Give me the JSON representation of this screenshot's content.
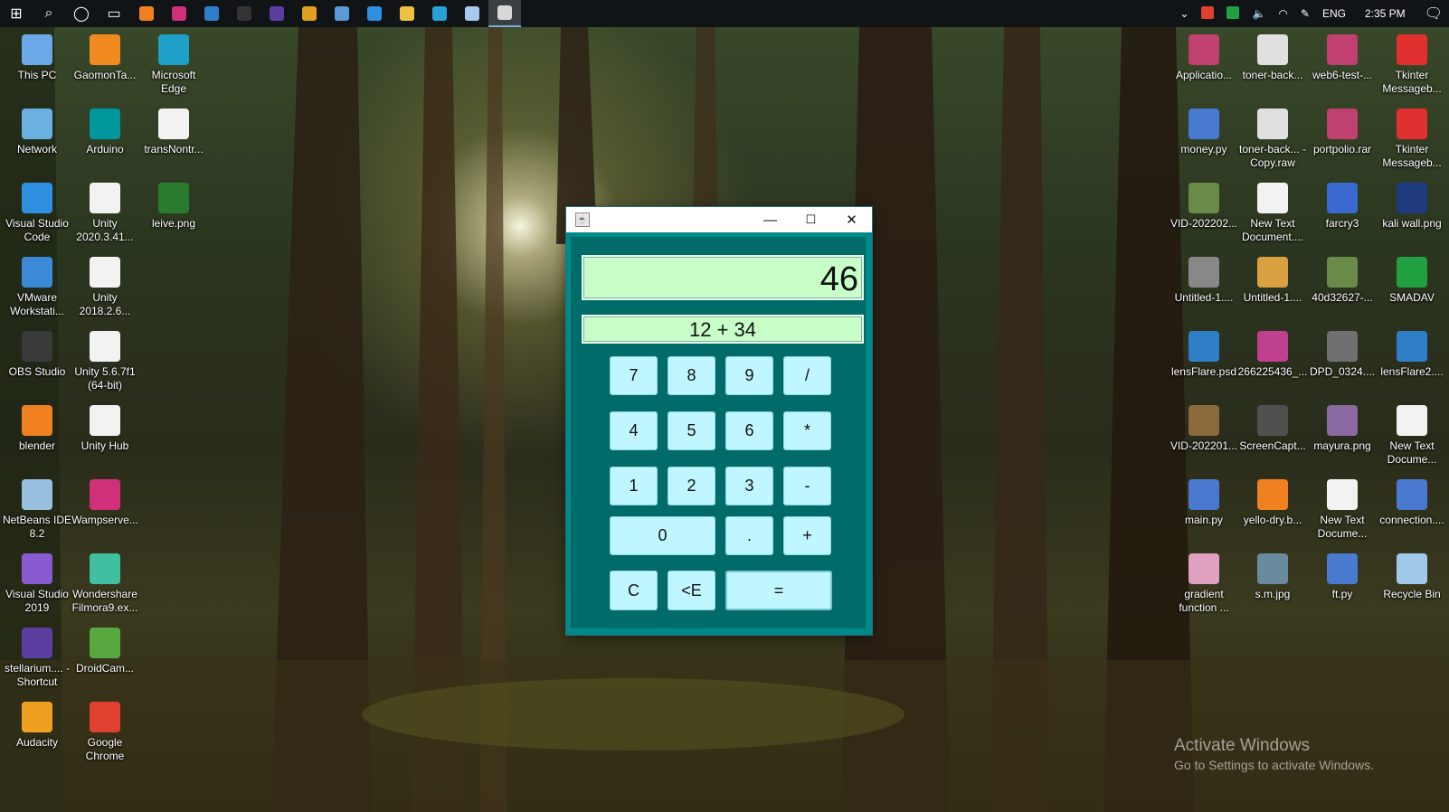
{
  "taskbar": {
    "apps": [
      {
        "name": "start",
        "glyph": "⊞",
        "color": "#ffffff"
      },
      {
        "name": "search",
        "glyph": "⌕",
        "color": "#ffffff"
      },
      {
        "name": "cortana",
        "glyph": "◯",
        "color": "#ffffff"
      },
      {
        "name": "task-view",
        "glyph": "▭",
        "color": "#ffffff"
      },
      {
        "name": "blender",
        "glyph": "",
        "color": "#f08020"
      },
      {
        "name": "pink-app",
        "glyph": "",
        "color": "#d0307a"
      },
      {
        "name": "photoshop",
        "glyph": "",
        "color": "#2f7fc8"
      },
      {
        "name": "terminal",
        "glyph": "",
        "color": "#333333"
      },
      {
        "name": "stellarium",
        "glyph": "",
        "color": "#5a3fa0"
      },
      {
        "name": "red-app",
        "glyph": "",
        "color": "#e0a020"
      },
      {
        "name": "window-app",
        "glyph": "",
        "color": "#5b9bd5"
      },
      {
        "name": "vscode",
        "glyph": "",
        "color": "#2f8fe0"
      },
      {
        "name": "file-explorer",
        "glyph": "",
        "color": "#f0c040"
      },
      {
        "name": "edge",
        "glyph": "",
        "color": "#2aa0d8"
      },
      {
        "name": "cube-app",
        "glyph": "",
        "color": "#a8c8f0"
      },
      {
        "name": "java-app",
        "glyph": "",
        "color": "#d8d8d8"
      }
    ],
    "tray": {
      "language": "ENG",
      "time": "2:35 PM"
    }
  },
  "desktop": {
    "left_icons": [
      {
        "label": "This PC",
        "color": "#6aa8e8"
      },
      {
        "label": "GaomonTa...",
        "color": "#f08a20"
      },
      {
        "label": "Microsoft Edge",
        "color": "#1fa0c8"
      },
      {
        "label": "Network",
        "color": "#6ab0e0"
      },
      {
        "label": "Arduino",
        "color": "#00979c"
      },
      {
        "label": "transNontr...",
        "color": "#f2f2f2"
      },
      {
        "label": "Visual Studio Code",
        "color": "#2f8fe0"
      },
      {
        "label": "Unity 2020.3.41...",
        "color": "#f2f2f2"
      },
      {
        "label": "leive.png",
        "color": "#2a7a30"
      },
      {
        "label": "VMware Workstati...",
        "color": "#3a8ad8"
      },
      {
        "label": "Unity 2018.2.6...",
        "color": "#f2f2f2"
      },
      {
        "label": "OBS Studio",
        "color": "#3a3a3a"
      },
      {
        "label": "Unity 5.6.7f1 (64-bit)",
        "color": "#f2f2f2"
      },
      {
        "label": "blender",
        "color": "#f08020"
      },
      {
        "label": "Unity Hub",
        "color": "#f2f2f2"
      },
      {
        "label": "NetBeans IDE 8.2",
        "color": "#9ac0e0"
      },
      {
        "label": "Wampserve...",
        "color": "#d0307a"
      },
      {
        "label": "Visual Studio 2019",
        "color": "#8a5ad0"
      },
      {
        "label": "Wondershare Filmora9.ex...",
        "color": "#40c0a0"
      },
      {
        "label": "stellarium.... - Shortcut",
        "color": "#5a3fa0"
      },
      {
        "label": "DroidCam...",
        "color": "#58a840"
      },
      {
        "label": "Audacity",
        "color": "#f0a020"
      },
      {
        "label": "Google Chrome",
        "color": "#e04030"
      }
    ],
    "right_icons": [
      {
        "label": "Applicatio...",
        "color": "#c04070"
      },
      {
        "label": "toner-back...",
        "color": "#e0e0e0"
      },
      {
        "label": "web6-test-...",
        "color": "#c04070"
      },
      {
        "label": "Tkinter Messageb...",
        "color": "#e03030"
      },
      {
        "label": "money.py",
        "color": "#4a7ad0"
      },
      {
        "label": "toner-back... - Copy.raw",
        "color": "#e0e0e0"
      },
      {
        "label": "portpolio.rar",
        "color": "#c04070"
      },
      {
        "label": "Tkinter Messageb...",
        "color": "#e03030"
      },
      {
        "label": "VID-202202...",
        "color": "#6a8a4a"
      },
      {
        "label": "New Text Document....",
        "color": "#f2f2f2"
      },
      {
        "label": "farcry3",
        "color": "#3a6ad0"
      },
      {
        "label": "kali wall.png",
        "color": "#203a80"
      },
      {
        "label": "Untitled-1....",
        "color": "#888888"
      },
      {
        "label": "Untitled-1....",
        "color": "#d8a040"
      },
      {
        "label": "40d32627-...",
        "color": "#6a8a4a"
      },
      {
        "label": "SMADAV",
        "color": "#20a040"
      },
      {
        "label": "lensFlare.psd",
        "color": "#2f7fc8"
      },
      {
        "label": "266225436_...",
        "color": "#c04090"
      },
      {
        "label": "DPD_0324....",
        "color": "#707070"
      },
      {
        "label": "lensFlare2....",
        "color": "#2f7fc8"
      },
      {
        "label": "VID-202201...",
        "color": "#8a6a3a"
      },
      {
        "label": "ScreenCapt...",
        "color": "#505050"
      },
      {
        "label": "mayura.png",
        "color": "#8a6aa0"
      },
      {
        "label": "New Text Docume...",
        "color": "#f2f2f2"
      },
      {
        "label": "main.py",
        "color": "#4a7ad0"
      },
      {
        "label": "yello-dry.b...",
        "color": "#f08020"
      },
      {
        "label": "New Text Docume...",
        "color": "#f2f2f2"
      },
      {
        "label": "connection....",
        "color": "#4a7ad0"
      },
      {
        "label": "gradient function ...",
        "color": "#e0a0c0"
      },
      {
        "label": "s.m.jpg",
        "color": "#6a8aa0"
      },
      {
        "label": "ft.py",
        "color": "#4a7ad0"
      },
      {
        "label": "Recycle Bin",
        "color": "#a0c8e8"
      }
    ]
  },
  "watermark": {
    "line1": "Activate Windows",
    "line2": "Go to Settings to activate Windows."
  },
  "calculator": {
    "window": {
      "minimize": "—",
      "maximize": "☐",
      "close": "✕"
    },
    "display": "46",
    "expression": "12 + 34",
    "keys": {
      "k7": "7",
      "k8": "8",
      "k9": "9",
      "div": "/",
      "k4": "4",
      "k5": "5",
      "k6": "6",
      "mul": "*",
      "k1": "1",
      "k2": "2",
      "k3": "3",
      "sub": "-",
      "k0": "0",
      "dot": ".",
      "add": "+",
      "clear": "C",
      "back": "<E",
      "equals": "="
    }
  }
}
